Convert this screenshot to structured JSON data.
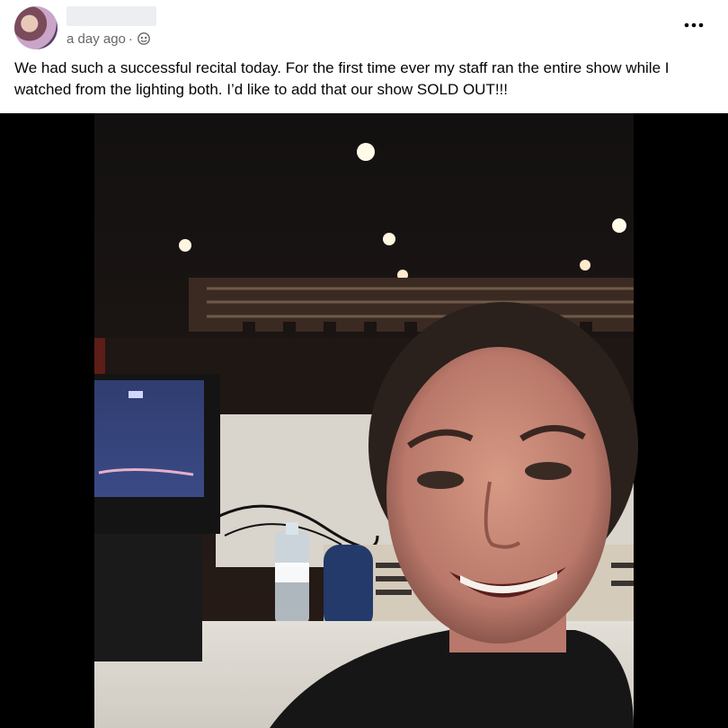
{
  "post": {
    "timestamp": "a day ago",
    "separator": "·",
    "audience_icon": "friends-icon",
    "more_icon": "more-horizontal-icon",
    "more_label": "•••",
    "text": "We had such a successful recital today.  For the first time ever my staff ran the entire show while I watched from the lighting both. I’d like to add that our show SOLD OUT!!!"
  },
  "colors": {
    "meta_text": "#65676b",
    "body_text": "#050505",
    "photo_background": "#000000"
  }
}
